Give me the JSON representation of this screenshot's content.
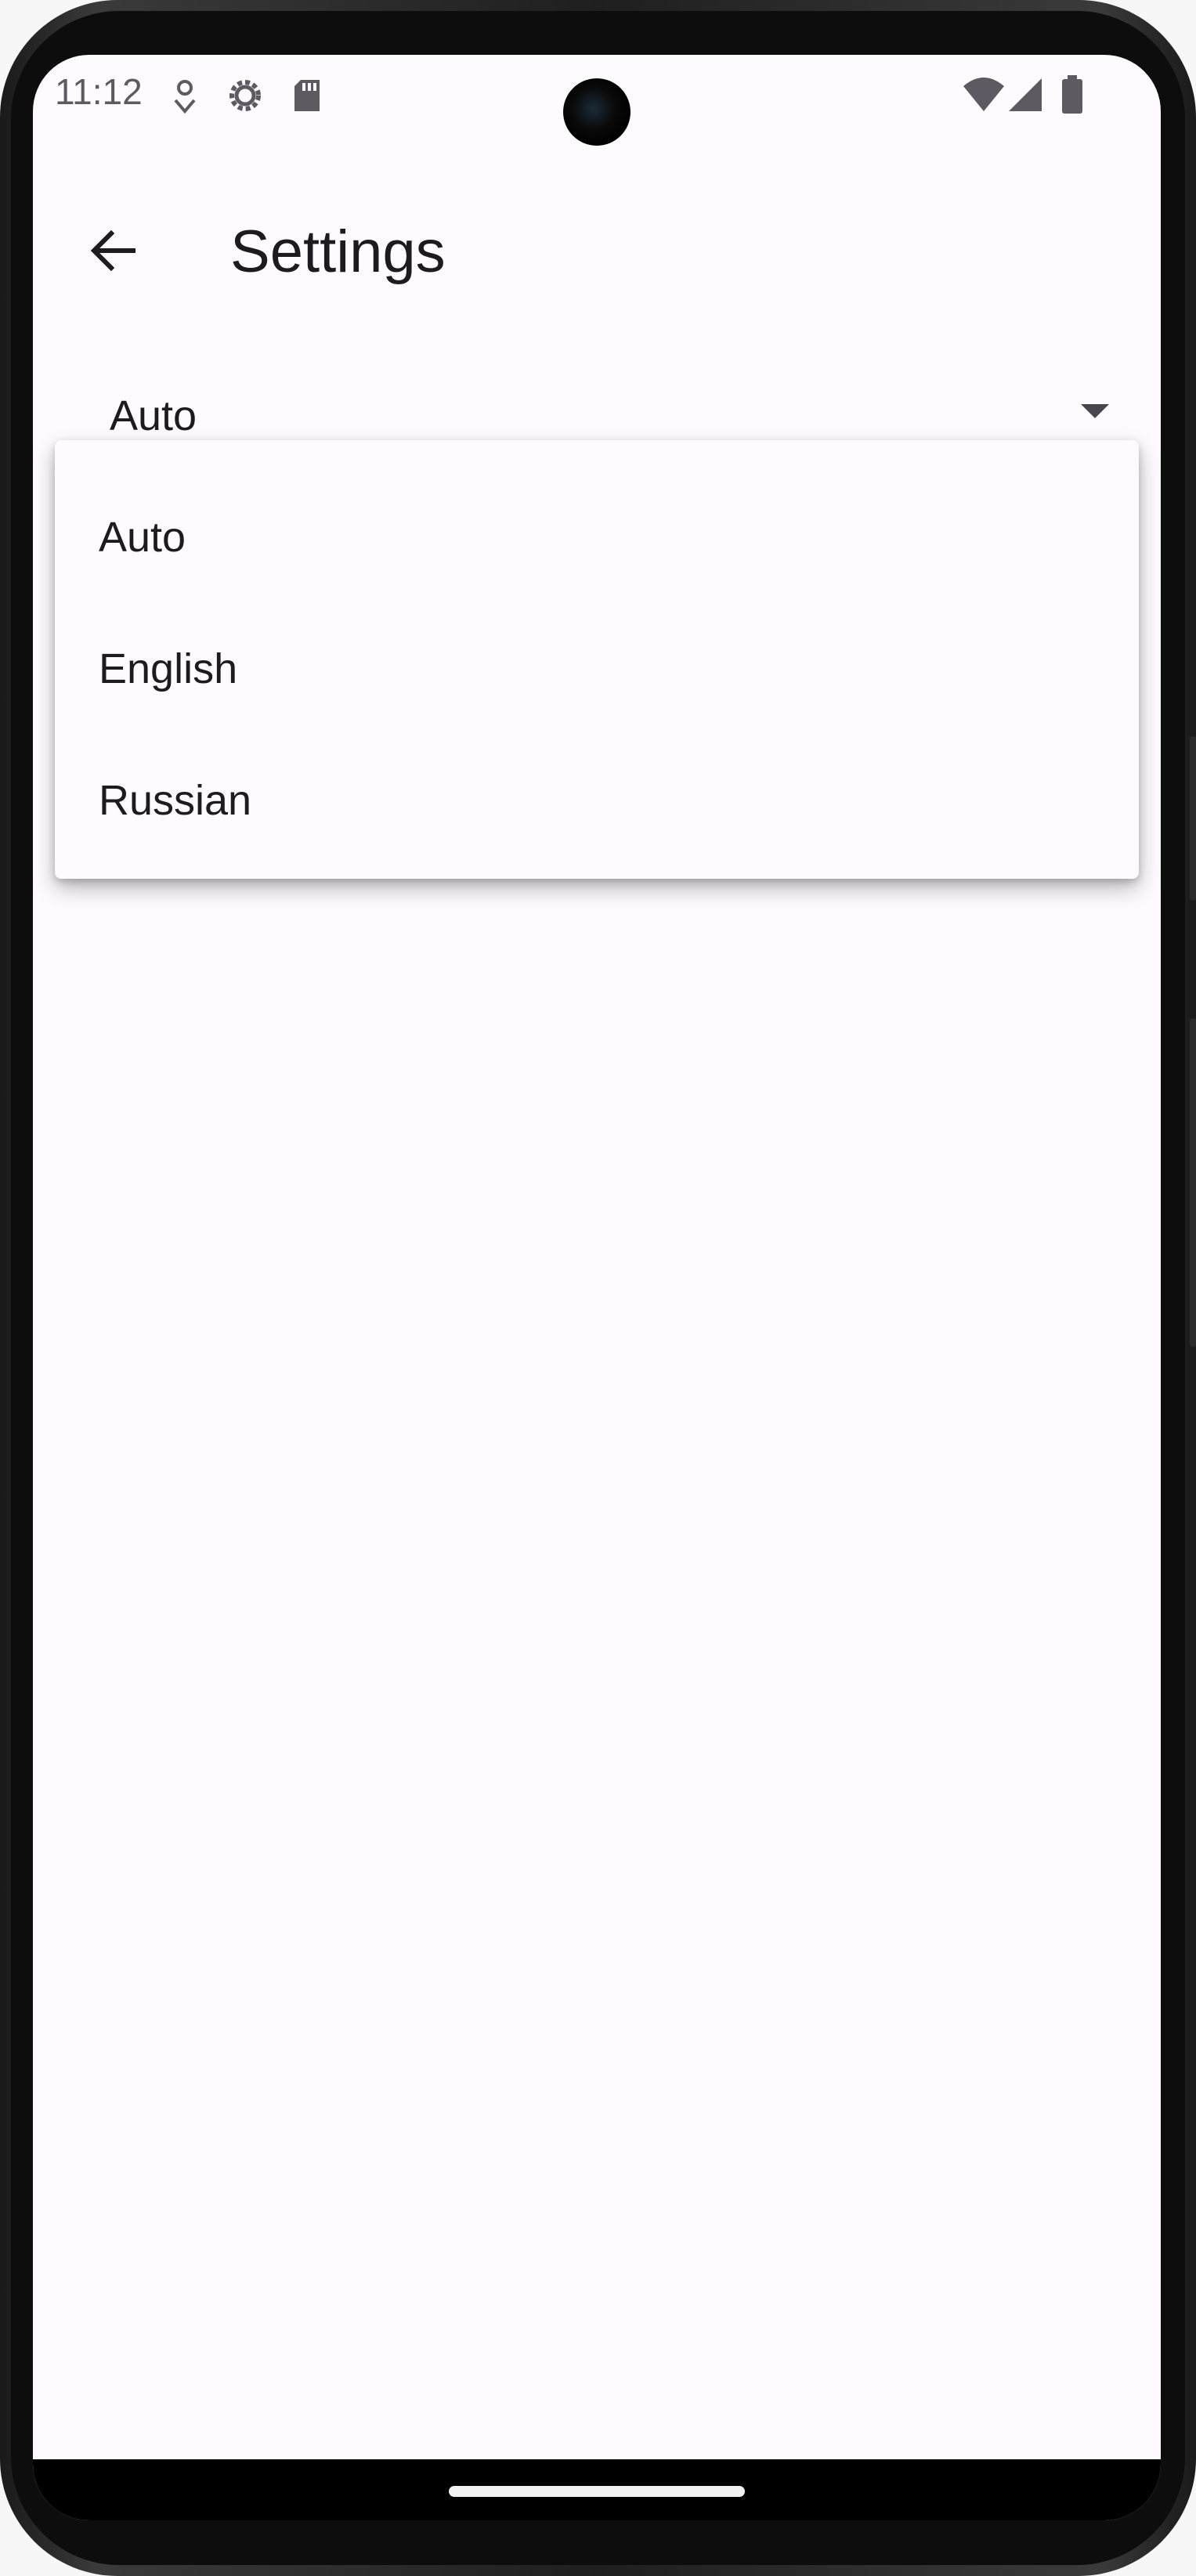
{
  "status_bar": {
    "time": "11:12",
    "left_icons": [
      "location-icon",
      "settings-gear-icon",
      "sd-card-icon"
    ],
    "right_icons": [
      "wifi-icon",
      "cellular-signal-icon",
      "battery-icon"
    ]
  },
  "app_bar": {
    "title": "Settings",
    "back_icon": "arrow-back-icon"
  },
  "language_dropdown": {
    "selected_value": "Auto",
    "options": [
      "Auto",
      "English",
      "Russian"
    ],
    "arrow_icon": "dropdown-arrow-icon"
  },
  "colors": {
    "background": "#fefbfe",
    "text": "#1d1b20",
    "status_icons": "#5d5b61"
  }
}
